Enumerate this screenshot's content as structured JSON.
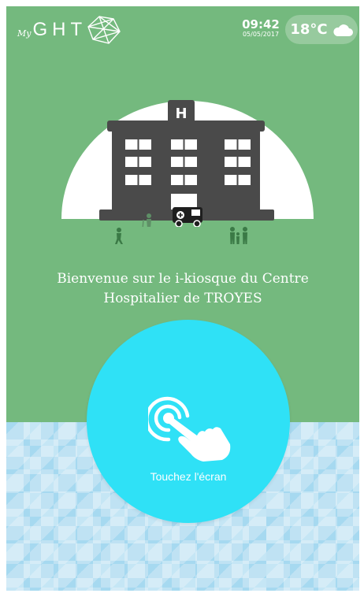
{
  "header": {
    "logo": {
      "prefix": "My",
      "name": "GHT"
    },
    "clock": {
      "time": "09:42",
      "date": "05/05/2017"
    },
    "weather": {
      "temperature": "18°C",
      "icon": "cloud-icon"
    }
  },
  "illustration": {
    "building_sign": "H",
    "icons": [
      "hospital-building-icon",
      "ambulance-icon",
      "walking-person-icon",
      "elderly-person-icon",
      "family-icon"
    ]
  },
  "welcome": {
    "line1": "Bienvenue sur le i-kiosque du Centre",
    "line2": "Hospitalier de TROYES"
  },
  "touch_button": {
    "label": "Touchez l'écran",
    "icon": "touch-hand-icon"
  },
  "colors": {
    "green_background": "#74b97e",
    "touch_circle": "#2fe1f6",
    "building": "#4a4a4a",
    "pattern_blue": "#bfe2f3"
  }
}
